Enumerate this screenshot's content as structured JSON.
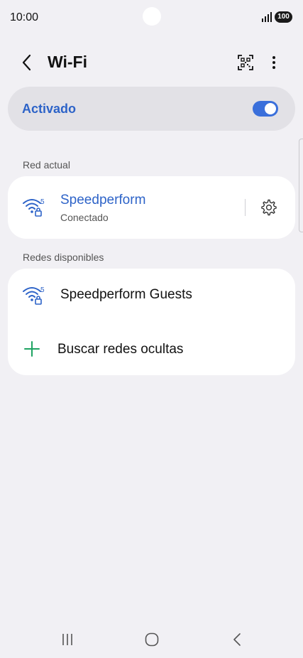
{
  "status_bar": {
    "time": "10:00",
    "battery": "100"
  },
  "header": {
    "title": "Wi-Fi"
  },
  "toggle": {
    "label": "Activado",
    "on": true
  },
  "sections": {
    "current_title": "Red actual",
    "available_title": "Redes disponibles"
  },
  "current_network": {
    "name": "Speedperform",
    "status": "Conectado",
    "band": "5"
  },
  "available_networks": [
    {
      "name": "Speedperform Guests",
      "band": "5"
    }
  ],
  "hidden_networks": {
    "label": "Buscar redes ocultas"
  },
  "colors": {
    "accent": "#3a6fdb",
    "link": "#2d63c8",
    "plus": "#1ea362",
    "background": "#f1f0f4"
  },
  "icons": [
    "back-icon",
    "qr-code-icon",
    "more-vertical-icon",
    "wifi-lock-icon",
    "gear-icon",
    "plus-icon",
    "recents-icon",
    "home-icon",
    "nav-back-icon"
  ]
}
